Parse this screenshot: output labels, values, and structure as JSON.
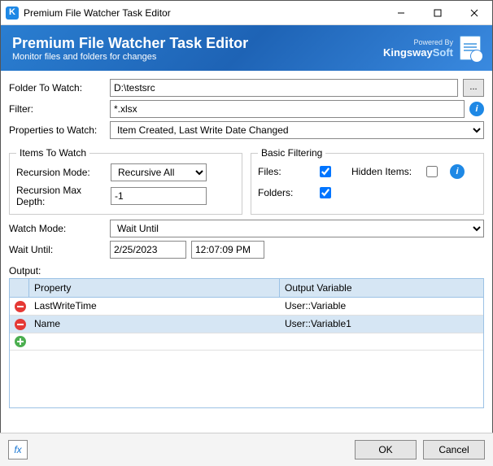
{
  "window": {
    "title": "Premium File Watcher Task Editor"
  },
  "header": {
    "title": "Premium File Watcher Task Editor",
    "subtitle": "Monitor files and folders for changes",
    "powered_by_label": "Powered By",
    "brand_prefix": "Kingsway",
    "brand_suffix": "Soft"
  },
  "labels": {
    "folder_to_watch": "Folder To Watch:",
    "filter": "Filter:",
    "properties_to_watch": "Properties to Watch:",
    "items_to_watch_legend": "Items To Watch",
    "basic_filtering_legend": "Basic Filtering",
    "recursion_mode": "Recursion Mode:",
    "recursion_max_depth": "Recursion Max Depth:",
    "files": "Files:",
    "folders": "Folders:",
    "hidden_items": "Hidden Items:",
    "watch_mode": "Watch Mode:",
    "wait_until": "Wait Until:",
    "output": "Output:",
    "col_property": "Property",
    "col_output_variable": "Output Variable",
    "browse": "...",
    "ok": "OK",
    "cancel": "Cancel",
    "fx": "fx"
  },
  "values": {
    "folder_to_watch": "D:\\testsrc",
    "filter": "*.xlsx",
    "properties_to_watch": "Item Created, Last Write Date Changed",
    "recursion_mode": "Recursive All",
    "recursion_max_depth": "-1",
    "files_checked": true,
    "folders_checked": true,
    "hidden_checked": false,
    "watch_mode": "Wait Until",
    "date": "2/25/2023",
    "time": "12:07:09 PM"
  },
  "output_grid": [
    {
      "property": "LastWriteTime",
      "variable": "User::Variable",
      "selected": false
    },
    {
      "property": "Name",
      "variable": "User::Variable1",
      "selected": true
    }
  ]
}
